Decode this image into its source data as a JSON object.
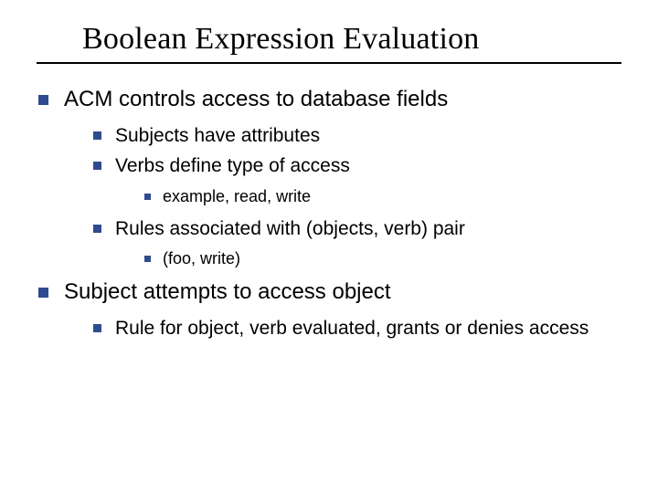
{
  "title": "Boolean Expression Evaluation",
  "l1": [
    {
      "text": "ACM controls access to database fields",
      "l2": [
        {
          "text": "Subjects have attributes"
        },
        {
          "text": "Verbs define type of access",
          "l3": [
            {
              "text": "example, read, write"
            }
          ]
        },
        {
          "text": "Rules associated with (objects, verb) pair",
          "l3": [
            {
              "text": "(foo, write)"
            }
          ]
        }
      ]
    },
    {
      "text": "Subject attempts to access object",
      "l2": [
        {
          "text": "Rule for object, verb evaluated, grants or denies access"
        }
      ]
    }
  ]
}
